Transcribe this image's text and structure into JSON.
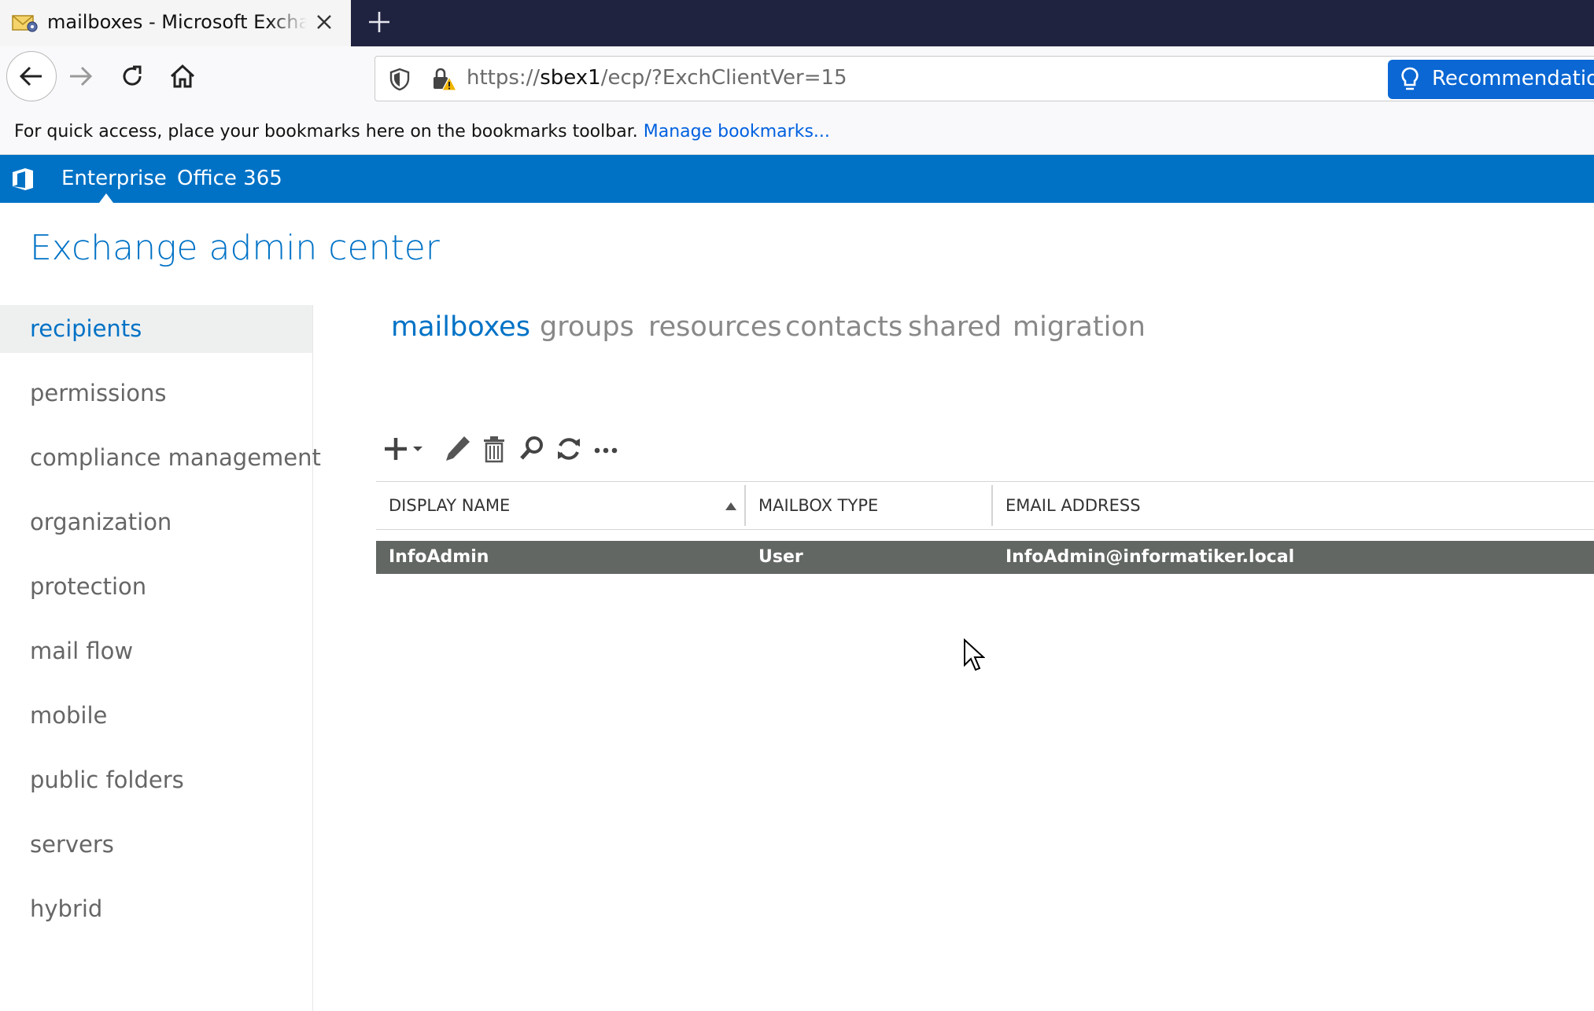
{
  "browser": {
    "tab": {
      "title": "mailboxes - Microsoft Exchange",
      "favicon": "envelope-gear-icon",
      "close_icon": "close-icon"
    },
    "new_tab_icon": "plus-icon",
    "nav": {
      "back_icon": "arrow-left-icon",
      "forward_icon": "arrow-right-icon",
      "reload_icon": "reload-icon",
      "home_icon": "home-icon"
    },
    "url": {
      "scheme": "https://",
      "host": "sbex1",
      "path": "/ecp/?ExchClientVer=15"
    },
    "recommendation_label": "Recommendation",
    "bookmarks_bar": {
      "text": "For quick access, place your bookmarks here on the bookmarks toolbar.",
      "link": "Manage bookmarks..."
    }
  },
  "suite_bar": {
    "logo": "office-logo-icon",
    "links": [
      "Enterprise",
      "Office 365"
    ],
    "active": "Enterprise"
  },
  "app": {
    "title": "Exchange admin center"
  },
  "left_nav": {
    "items": [
      {
        "label": "recipients",
        "active": true
      },
      {
        "label": "permissions"
      },
      {
        "label": "compliance management"
      },
      {
        "label": "organization"
      },
      {
        "label": "protection"
      },
      {
        "label": "mail flow"
      },
      {
        "label": "mobile"
      },
      {
        "label": "public folders"
      },
      {
        "label": "servers"
      },
      {
        "label": "hybrid"
      }
    ]
  },
  "sub_nav": {
    "items": [
      {
        "label": "mailboxes",
        "active": true
      },
      {
        "label": "groups"
      },
      {
        "label": "resources"
      },
      {
        "label": "contacts"
      },
      {
        "label": "shared"
      },
      {
        "label": "migration"
      }
    ]
  },
  "toolbar": {
    "icons": [
      "add-dropdown-icon",
      "edit-icon",
      "delete-icon",
      "search-icon",
      "refresh-icon",
      "more-icon"
    ]
  },
  "grid": {
    "columns": [
      "DISPLAY NAME",
      "MAILBOX TYPE",
      "EMAIL ADDRESS"
    ],
    "sort_column": "DISPLAY NAME",
    "sort_direction": "ascending",
    "rows": [
      {
        "display_name": "InfoAdmin",
        "mailbox_type": "User",
        "email": "InfoAdmin@informatiker.local",
        "selected": true
      }
    ]
  },
  "colors": {
    "suite_blue": "#0072c6",
    "tab_strip": "#202340",
    "selected_row": "#626763",
    "link_blue": "#0060df"
  }
}
